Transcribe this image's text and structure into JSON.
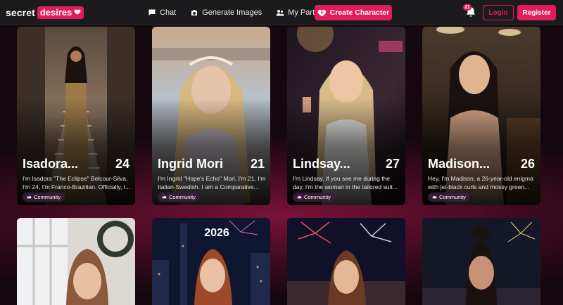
{
  "brand": {
    "part1": "secret",
    "part2": "desires"
  },
  "nav": {
    "chat": "Chat",
    "generate_images": "Generate Images",
    "my_partners": "My Partners",
    "create_character": "Create Character"
  },
  "notifications": {
    "count": "21"
  },
  "auth": {
    "login": "Login",
    "register": "Register"
  },
  "colors": {
    "accent": "#e31b5c",
    "topbar": "#1b1b1d",
    "background": "#130810"
  },
  "cards": [
    {
      "name": "Isadora...",
      "age": "24",
      "desc": "I'm Isadora \"The Eclipse\" Belcour-Silva, I'm 24, I'm Franco-Brazilian. Officially, I...",
      "tag": "Community"
    },
    {
      "name": "Ingrid Mori",
      "age": "21",
      "desc": "I'm Ingrid \"Hope's Echo\" Mori, I'm 21, I'm Italian-Swedish. I am a Comparative...",
      "tag": "Community"
    },
    {
      "name": "Lindsay...",
      "age": "27",
      "desc": "I'm Lindsay. If you see me during the day, I'm the woman in the tailored suit...",
      "tag": "Community"
    },
    {
      "name": "Madison...",
      "age": "26",
      "desc": "Hey, I'm Madison, a 26-year-old enigma with jet-black curls and mossy green...",
      "tag": "Community"
    }
  ],
  "row2_fireworks_text": "2026"
}
